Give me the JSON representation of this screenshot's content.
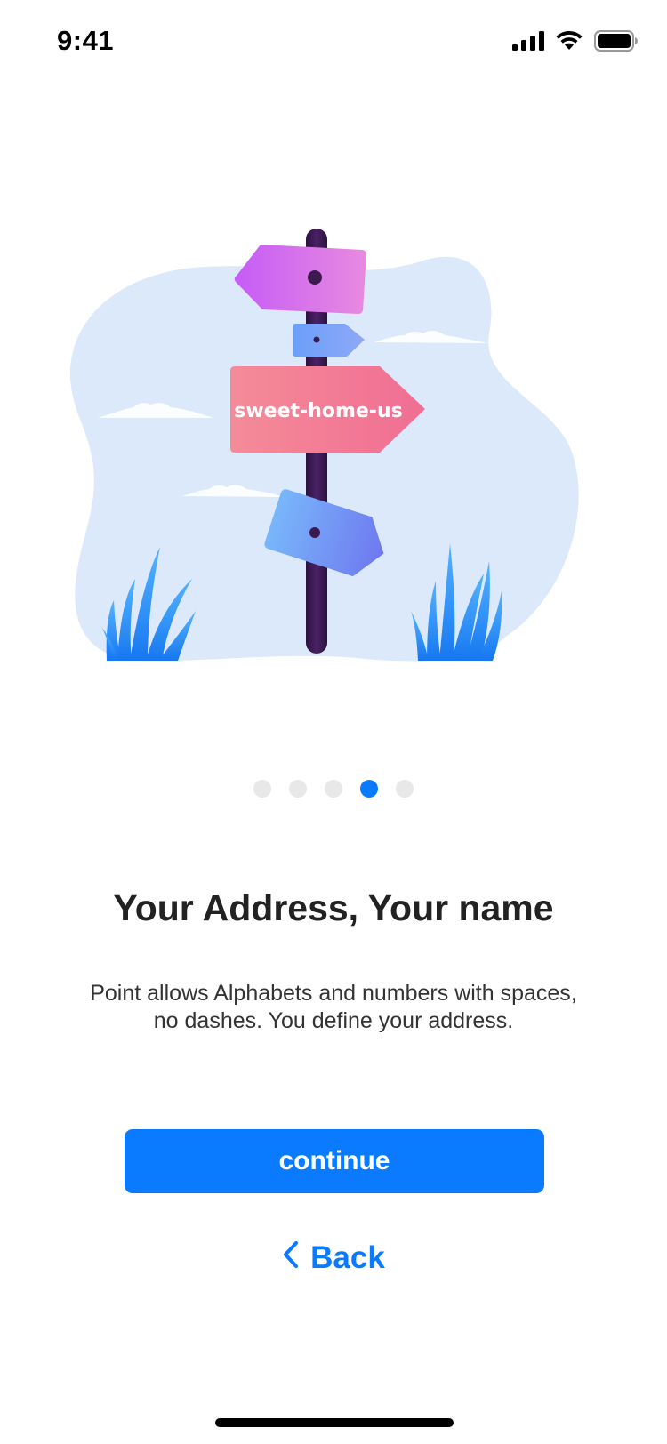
{
  "status_bar": {
    "time": "9:41"
  },
  "illustration": {
    "sign_text": "sweet-home-us"
  },
  "pagination": {
    "total": 5,
    "active_index": 3
  },
  "content": {
    "title": "Your Address, Your name",
    "description_line1": "Point allows Alphabets and numbers with spaces,",
    "description_line2": "no dashes. You define your address."
  },
  "actions": {
    "continue_label": "continue",
    "back_label": "Back"
  },
  "colors": {
    "accent": "#0a7bff",
    "blob": "#dbe9fb",
    "sign_pink": "#f2718f",
    "sign_purple": "#c65df5",
    "pole": "#3b1a4f"
  }
}
